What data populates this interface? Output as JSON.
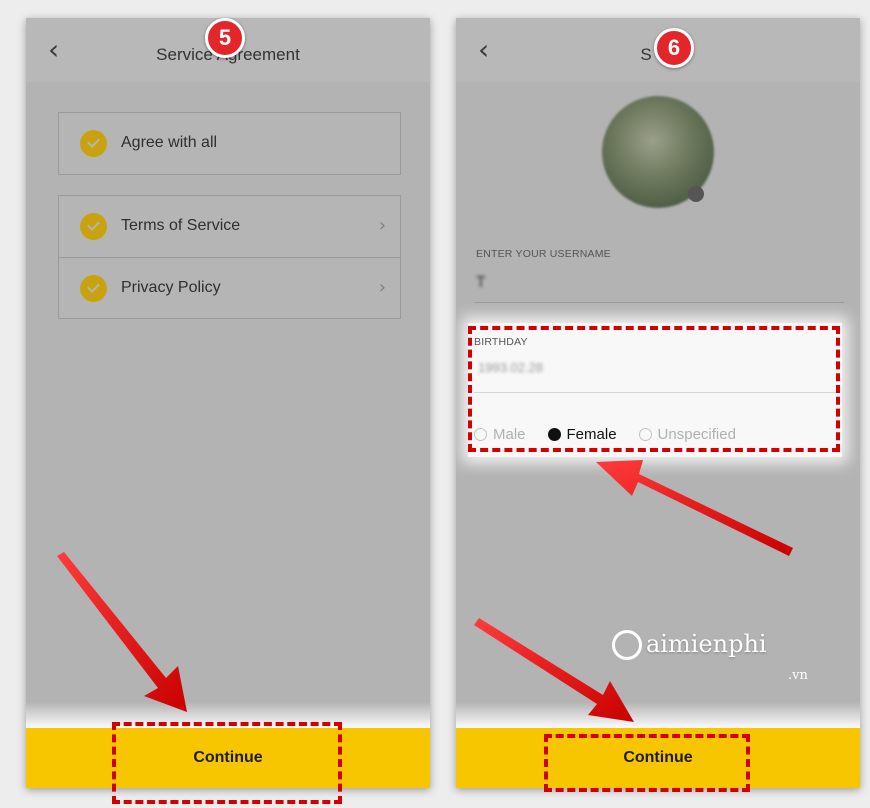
{
  "left_screen": {
    "title": "Service Agreement",
    "step_number": "5",
    "agreements": {
      "agree_all": "Agree with all",
      "items": [
        {
          "label": "Terms of Service"
        },
        {
          "label": "Privacy Policy"
        }
      ]
    },
    "continue_label": "Continue"
  },
  "right_screen": {
    "title": "S",
    "step_number": "6",
    "username_caption": "ENTER YOUR USERNAME",
    "username_value": "T",
    "birthday_caption": "BIRTHDAY",
    "birthday_value": "1993.02.28",
    "gender_options": [
      "Male",
      "Female",
      "Unspecified"
    ],
    "gender_selected": "Female",
    "continue_label": "Continue"
  },
  "watermark": {
    "brand": "aimienphi",
    "suffix": ".vn"
  },
  "colors": {
    "accent_yellow": "#f8c600",
    "check_gold": "#c9a30f",
    "annotation_red": "#d40000"
  }
}
